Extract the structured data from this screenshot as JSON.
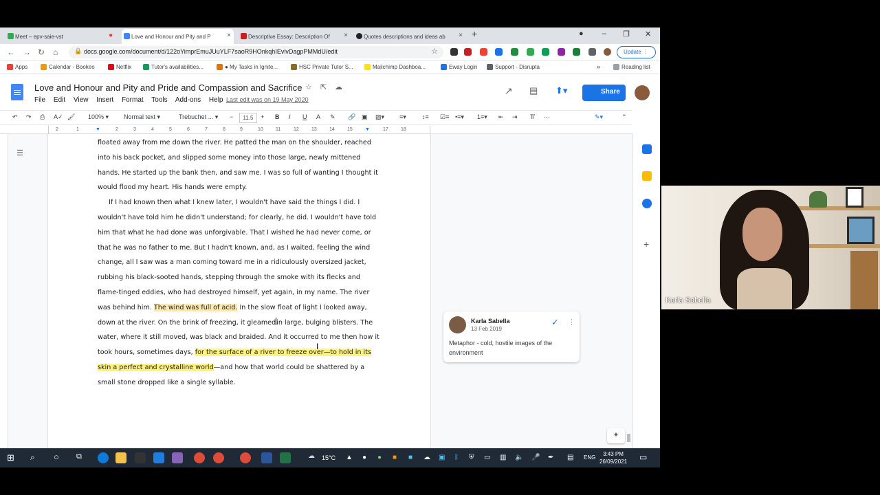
{
  "browser": {
    "tabs": [
      {
        "label": "Meet – epv-saie-vst",
        "color": "#34a853",
        "active": false
      },
      {
        "label": "Love and Honour and Pity and P",
        "color": "#4285f4",
        "active": true
      },
      {
        "label": "Descriptive Essay: Description Of",
        "color": "#c5221f",
        "active": false
      },
      {
        "label": "Quotes descriptions and ideas ab",
        "color": "#202124",
        "active": false
      }
    ],
    "url": "docs.google.com/document/d/122oYimprEmuJUuYLF7saoR9HOnkqhIEvlvDagpPMMdU/edit",
    "update_label": "Update",
    "bookmarks": [
      {
        "label": "Apps",
        "color": "#ea4335"
      },
      {
        "label": "Calendar - Bookeo",
        "color": "#f29900"
      },
      {
        "label": "Netflix",
        "color": "#e50914"
      },
      {
        "label": "Tutor's availabilities...",
        "color": "#0f9d58"
      },
      {
        "label": "● My Tasks in Ignite...",
        "color": "#e37400"
      },
      {
        "label": "HSC Private Tutor S...",
        "color": "#8a6d1d"
      },
      {
        "label": "Mailchimp Dashboa...",
        "color": "#ffe01b"
      },
      {
        "label": "Eway Login",
        "color": "#1a73e8"
      },
      {
        "label": "Support - Disrupta",
        "color": "#5f6368"
      }
    ],
    "reading_list": "Reading list"
  },
  "doc": {
    "title": "Love and Honour and Pity and Pride and Compassion and Sacrifice",
    "menu": [
      "File",
      "Edit",
      "View",
      "Insert",
      "Format",
      "Tools",
      "Add-ons",
      "Help"
    ],
    "last_edit": "Last edit was on 19 May 2020",
    "share_label": "Share"
  },
  "toolbar": {
    "zoom": "100%",
    "style": "Normal text",
    "font": "Trebuchet ...",
    "font_size": "11.5"
  },
  "ruler": [
    "2",
    "1",
    "1",
    "2",
    "3",
    "4",
    "5",
    "6",
    "7",
    "8",
    "9",
    "10",
    "11",
    "12",
    "13",
    "14",
    "15",
    "16",
    "17",
    "18"
  ],
  "body": {
    "p1": "floated away from me down the river. He patted the man on the shoulder, reached into his back pocket, and slipped some money into those large, newly mittened hands. He started up the bank then, and saw me. I was so full of wanting I thought it would flood my heart. His hands were empty.",
    "p2_a": "If I had known then what I knew later, I wouldn't have said the things I did. I wouldn't have told him he didn't understand; for clearly, he did. I wouldn't have told him that what he had done was unforgivable. That I wished he had never come, or that he was no father to me. But I hadn't known, and, as I waited, feeling the wind change, all I saw was a man coming toward me in a ridiculously oversized jacket, rubbing his black-sooted hands, stepping through the smoke with its flecks and flame-tinged eddies, who had destroyed himself, yet again, in my name. The river was behind him. ",
    "p2_hl1": "The wind was full of acid.",
    "p2_b": " In the slow float of light I looked away, down at the river. On the brink of freezing, it gleamed",
    "p2_c": "in large, bulging blisters. The water, where it still moved, was black and braided. And it occurred to me then how it took hours, sometimes days, ",
    "p2_hl2": "for the surface of a river to freeze over—to hold in its skin a perfect and crystalline world",
    "p2_d": "—and how that world could be shattered by a small stone dropped like a single syllable."
  },
  "comment": {
    "author": "Karla Sabella",
    "date": "13 Feb 2019",
    "text": "Metaphor - cold, hostile images of the environment"
  },
  "taskbar": {
    "weather": "15°C",
    "lang": "ENG",
    "time": "3:43 PM",
    "date": "26/09/2021"
  },
  "webcam": {
    "name": "Karla Sabella"
  }
}
